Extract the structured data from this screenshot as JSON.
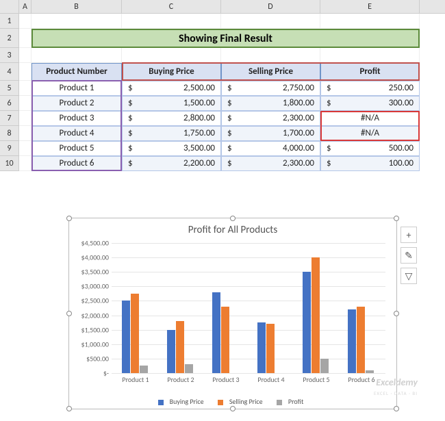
{
  "columns": [
    "A",
    "B",
    "C",
    "D",
    "E"
  ],
  "rows": [
    "1",
    "2",
    "3",
    "4",
    "5",
    "6",
    "7",
    "8",
    "9",
    "10"
  ],
  "title": "Showing Final Result",
  "headers": {
    "product": "Product Number",
    "buying": "Buying Price",
    "selling": "Selling Price",
    "profit": "Profit"
  },
  "table": [
    {
      "product": "Product 1",
      "buying": "2,500.00",
      "selling": "2,750.00",
      "profit": "250.00"
    },
    {
      "product": "Product 2",
      "buying": "1,500.00",
      "selling": "1,800.00",
      "profit": "300.00"
    },
    {
      "product": "Product 3",
      "buying": "2,800.00",
      "selling": "2,300.00",
      "profit": "#N/A"
    },
    {
      "product": "Product 4",
      "buying": "1,750.00",
      "selling": "1,700.00",
      "profit": "#N/A"
    },
    {
      "product": "Product 5",
      "buying": "3,500.00",
      "selling": "4,000.00",
      "profit": "500.00"
    },
    {
      "product": "Product 6",
      "buying": "2,200.00",
      "selling": "2,300.00",
      "profit": "100.00"
    }
  ],
  "currency": "$",
  "chart_data": {
    "type": "bar",
    "title": "Profit for All Products",
    "categories": [
      "Product 1",
      "Product 2",
      "Product 3",
      "Product 4",
      "Product 5",
      "Product 6"
    ],
    "series": [
      {
        "name": "Buying Price",
        "values": [
          2500,
          1500,
          2800,
          1750,
          3500,
          2200
        ],
        "color": "#4472c4"
      },
      {
        "name": "Selling Price",
        "values": [
          2750,
          1800,
          2300,
          1700,
          4000,
          2300
        ],
        "color": "#ed7d31"
      },
      {
        "name": "Profit",
        "values": [
          250,
          300,
          null,
          null,
          500,
          100
        ],
        "color": "#a5a5a5"
      }
    ],
    "ylim": [
      0,
      4500
    ],
    "yticks": [
      "$-",
      "$500.00",
      "$1,000.00",
      "$1,500.00",
      "$2,000.00",
      "$2,500.00",
      "$3,000.00",
      "$3,500.00",
      "$4,000.00",
      "$4,500.00"
    ],
    "xlabel": "",
    "ylabel": ""
  },
  "side_buttons": {
    "plus": "+",
    "brush": "✎",
    "filter": "▽"
  },
  "watermark": {
    "main": "Exceldemy",
    "sub": "EXCEL · DATA · BI"
  }
}
